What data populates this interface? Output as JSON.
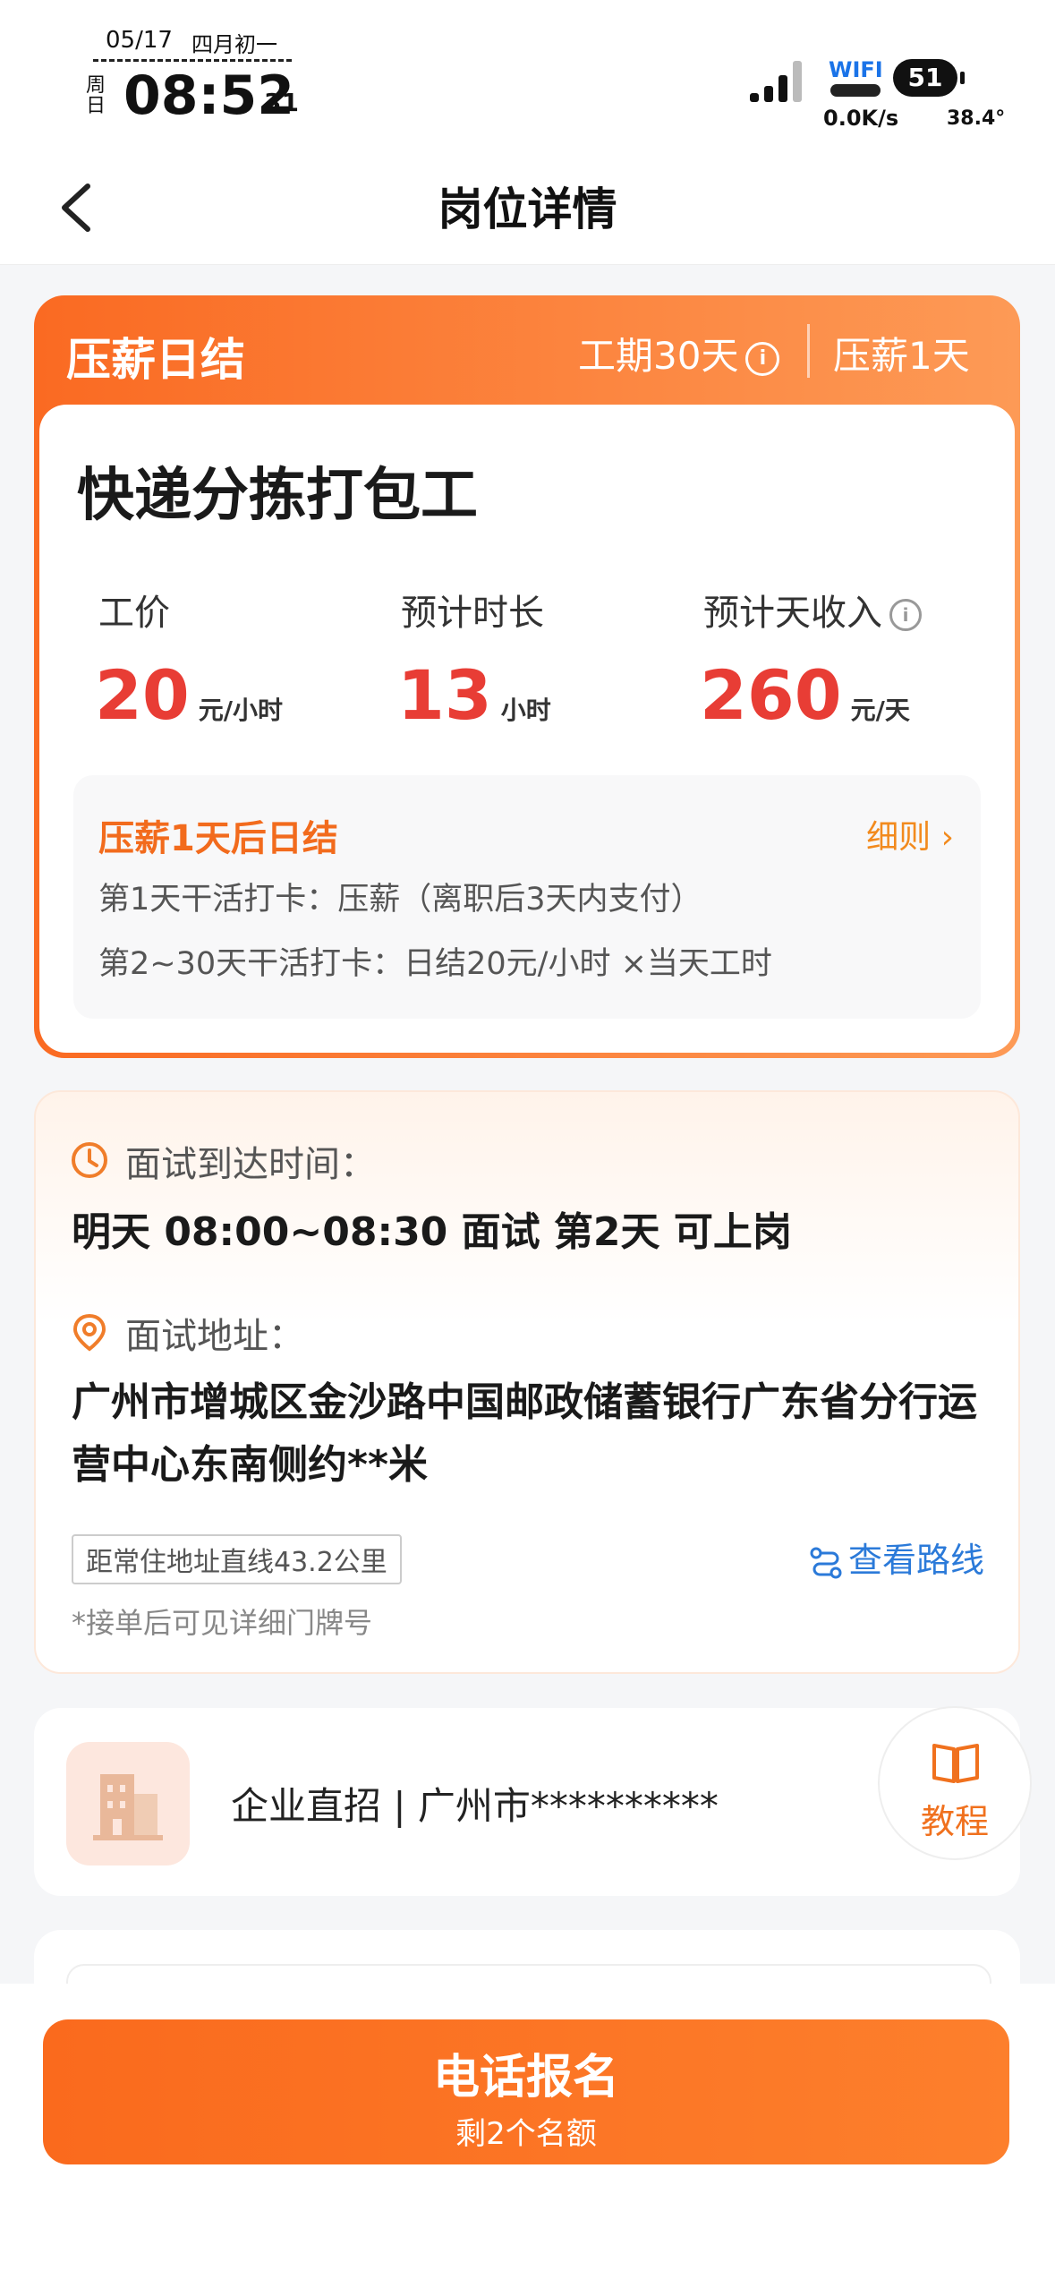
{
  "status_bar": {
    "date": "05/17",
    "lunar": "四月初一",
    "weekday": "周日",
    "time": "08:52",
    "seconds": "31",
    "wifi": "WIFI",
    "battery": "51",
    "net_speed": "0.0K/s",
    "temperature": "38.4°"
  },
  "nav": {
    "title": "岗位详情"
  },
  "job_card": {
    "header_title": "压薪日结",
    "period": "工期30天",
    "hold": "压薪1天",
    "title": "快递分拣打包工",
    "metrics": [
      {
        "label": "工价",
        "value": "20",
        "unit": "元/小时"
      },
      {
        "label": "预计时长",
        "value": "13",
        "unit": "小时"
      },
      {
        "label": "预计天收入",
        "value": "260",
        "unit": "元/天"
      }
    ],
    "rule": {
      "title": "压薪1天后日结",
      "link": "细则",
      "lines": [
        "第1天干活打卡：压薪（离职后3天内支付）",
        "第2~30天干活打卡：日结20元/小时 ×当天工时"
      ]
    }
  },
  "interview": {
    "time_label": "面试到达时间：",
    "time_value": "明天 08:00~08:30 面试 第2天 可上岗",
    "address_label": "面试地址：",
    "address_value": "广州市增城区金沙路中国邮政储蓄银行广东省分行运营中心东南侧约**米",
    "distance": "距常住地址直线43.2公里",
    "route": "查看路线",
    "note": "*接单后可见详细门牌号"
  },
  "company": {
    "text": "企业直招 | 广州市**********",
    "tutorial": "教程"
  },
  "cta": {
    "title": "电话报名",
    "subtitle": "剩2个名额"
  },
  "colors": {
    "accent": "#fa6a22",
    "price_red": "#e83d35",
    "link_blue": "#2b7ad9"
  }
}
